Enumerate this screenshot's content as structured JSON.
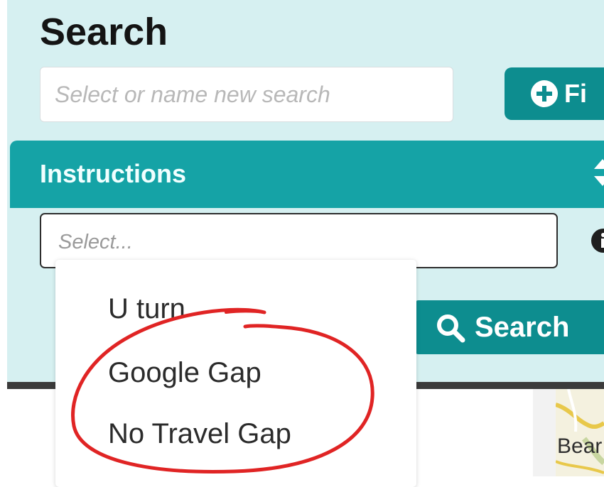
{
  "header": {
    "title": "Search",
    "search_name_placeholder": "Select or name new search",
    "filter_button_label": "Fi"
  },
  "instructions": {
    "title": "Instructions",
    "select_placeholder": "Select...",
    "options": [
      {
        "label": "U turn"
      },
      {
        "label": "Google Gap"
      },
      {
        "label": "No Travel Gap"
      }
    ]
  },
  "actions": {
    "search_button_label": "Search"
  },
  "map": {
    "visible_label": "Bear"
  },
  "colors": {
    "panel_bg": "#d6f0f1",
    "accent_dark": "#0d8d8f",
    "accent_header": "#15a3a6",
    "annotation": "#e02424"
  },
  "icons": [
    "plus-circle-icon",
    "sort-icon",
    "info-icon",
    "search-icon"
  ]
}
